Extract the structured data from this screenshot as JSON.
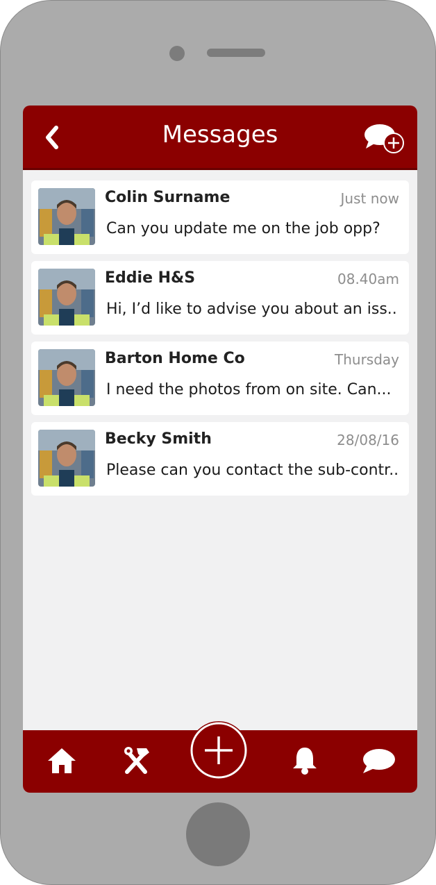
{
  "header": {
    "title": "Messages",
    "back_icon": "chevron-left-icon",
    "new_message_icon": "chat-bubble-plus-icon"
  },
  "colors": {
    "brand": "#8b0000",
    "background": "#f1f1f2",
    "card": "#ffffff",
    "timestamp": "#8d8d8d"
  },
  "messages": [
    {
      "name": "Colin Surname",
      "time": "Just now",
      "preview": "Can you update me on the job opp?"
    },
    {
      "name": "Eddie H&S",
      "time": "08.40am",
      "preview": "Hi, I’d like to advise you about an iss..."
    },
    {
      "name": "Barton Home Co",
      "time": "Thursday",
      "preview": "I need the photos from on site. Can..."
    },
    {
      "name": "Becky Smith",
      "time": "28/08/16",
      "preview": "Please can you contact the sub-contr..."
    }
  ],
  "bottom_nav": {
    "items": [
      "home-icon",
      "tools-icon",
      "add-icon",
      "bell-icon",
      "chat-icon"
    ]
  }
}
